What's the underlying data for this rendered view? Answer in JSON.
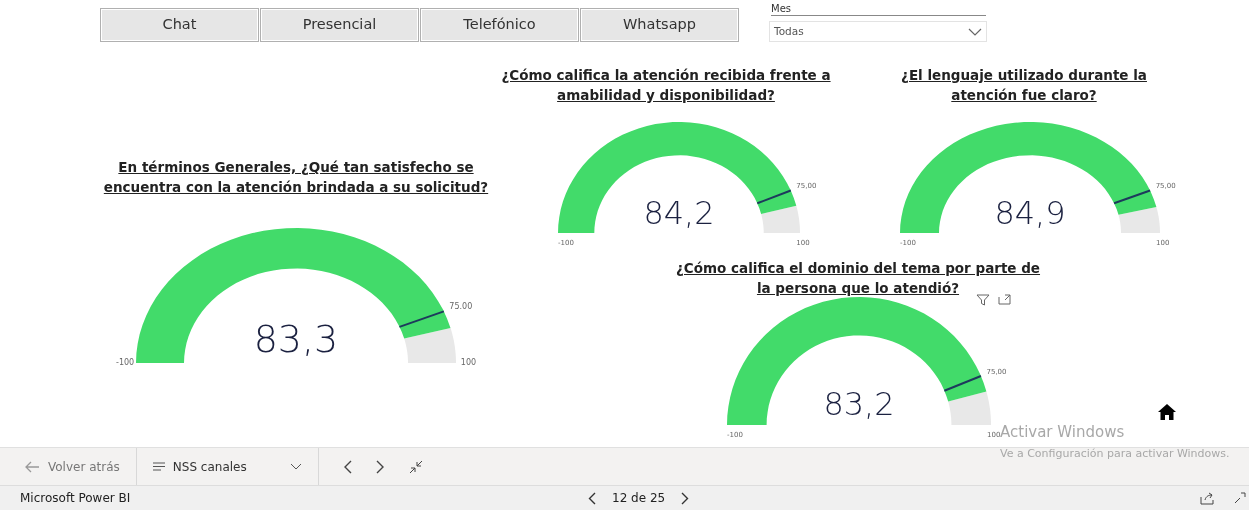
{
  "channel_buttons": [
    {
      "label": "Chat"
    },
    {
      "label": "Presencial"
    },
    {
      "label": "Telefónico"
    },
    {
      "label": "Whatsapp"
    }
  ],
  "month_slicer": {
    "label": "Mes",
    "value": "Todas"
  },
  "gauges": [
    {
      "title": "En términos Generales, ¿Qué tan satisfecho se encuentra con la atención brindada a su solicitud?",
      "value": "83,3",
      "min": "-100",
      "max": "100",
      "target": "75.00"
    },
    {
      "title": "¿Cómo califica la atención recibida frente a amabilidad y disponibilidad?",
      "value": "84,2",
      "min": "-100",
      "max": "100",
      "target": "75,00"
    },
    {
      "title": "¿El lenguaje utilizado durante la atención fue claro?",
      "value": "84,9",
      "min": "-100",
      "max": "100",
      "target": "75,00"
    },
    {
      "title": "¿Cómo califica el dominio del tema por parte de la persona que lo atendió?",
      "value": "83,2",
      "min": "-100",
      "max": "100",
      "target": "75,00",
      "header_icons": true
    }
  ],
  "os_notice": {
    "title": "Activar Windows",
    "text": "Ve a Configuración para activar Windows."
  },
  "nav_bar": {
    "back": "Volver atrás",
    "page_menu": "NSS canales"
  },
  "status_bar": {
    "app": "Microsoft Power BI",
    "page": "12 de 25"
  }
}
